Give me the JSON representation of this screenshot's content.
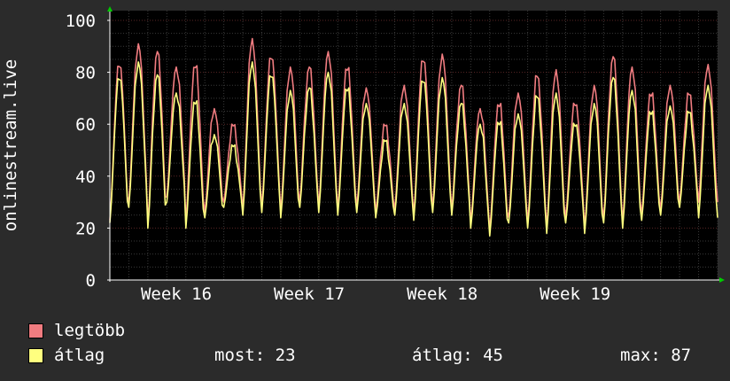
{
  "chart_data": {
    "type": "line",
    "ylabel": "onlinestream.live",
    "ylim": [
      0,
      100
    ],
    "y_ticks": [
      "0",
      "20",
      "40",
      "60",
      "80",
      "100"
    ],
    "x_ticks": [
      "Week 16",
      "Week 17",
      "Week 18",
      "Week 19"
    ],
    "series": [
      {
        "name": "legtöbb",
        "color": "#f07c80",
        "daily_peaks": [
          84,
          91,
          88,
          82,
          83,
          66,
          60,
          93,
          87,
          82,
          82,
          88,
          82,
          74,
          60,
          75,
          86,
          87,
          75,
          66,
          68,
          72,
          79,
          81,
          69,
          75,
          86,
          82,
          72,
          75,
          72,
          83
        ],
        "daily_troughs": [
          23,
          30,
          22,
          32,
          22,
          26,
          30,
          27,
          28,
          26,
          30,
          28,
          27,
          28,
          26,
          27,
          25,
          28,
          27,
          22,
          19,
          24,
          22,
          20,
          24,
          20,
          24,
          22,
          25,
          27,
          30,
          30
        ]
      },
      {
        "name": "átlag",
        "color": "#ffff7f",
        "daily_peaks": [
          79,
          84,
          79,
          72,
          69,
          56,
          52,
          84,
          80,
          73,
          74,
          80,
          74,
          68,
          54,
          68,
          78,
          78,
          68,
          60,
          61,
          64,
          71,
          72,
          61,
          68,
          78,
          73,
          65,
          67,
          65,
          75
        ],
        "daily_troughs": [
          22,
          28,
          20,
          30,
          20,
          24,
          28,
          25,
          26,
          24,
          28,
          26,
          25,
          26,
          24,
          25,
          23,
          26,
          25,
          20,
          17,
          22,
          20,
          18,
          22,
          18,
          22,
          20,
          23,
          25,
          28,
          24
        ]
      }
    ],
    "legend": {
      "position": "bottom-left"
    },
    "grid": true
  },
  "legend": {
    "max_label": "legtöbb",
    "avg_label": "átlag",
    "max_color": "#f07c80",
    "avg_color": "#ffff7f"
  },
  "stats": {
    "now": "most: 23",
    "avg": "átlag: 45",
    "max": "max: 87"
  }
}
